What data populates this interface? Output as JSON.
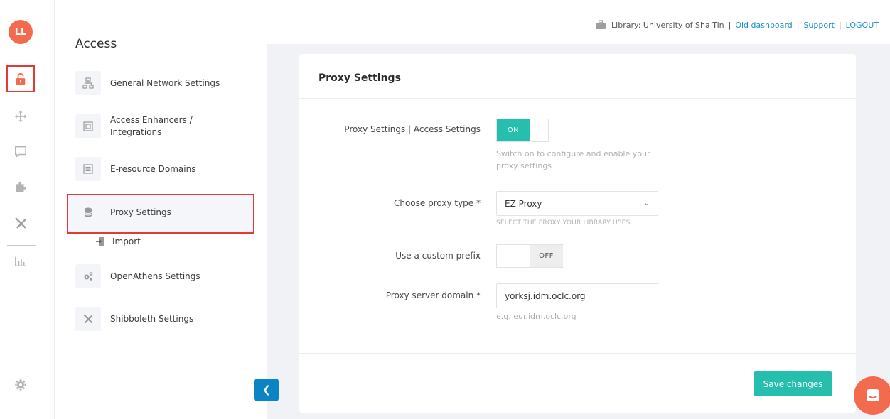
{
  "logo": {
    "text": "LL",
    "color": "#f26b4f"
  },
  "rail": {
    "items": [
      {
        "name": "lock-open-icon",
        "active": true
      },
      {
        "name": "move-arrows-icon",
        "active": false
      },
      {
        "name": "chat-square-icon",
        "active": false
      },
      {
        "name": "puzzle-icon",
        "active": false
      },
      {
        "name": "tools-icon",
        "active": false
      },
      {
        "name": "bar-chart-icon",
        "active": false
      },
      {
        "name": "gear-icon",
        "active": false
      }
    ]
  },
  "menu": {
    "title": "Access",
    "items": [
      {
        "label": "General Network Settings",
        "icon": "network-icon"
      },
      {
        "label": "Access Enhancers / Integrations",
        "icon": "integrations-icon"
      },
      {
        "label": "E-resource Domains",
        "icon": "list-icon"
      },
      {
        "label": "Proxy Settings",
        "icon": "database-icon",
        "active": true
      },
      {
        "label": "Import",
        "icon": "import-icon",
        "sub": true
      },
      {
        "label": "OpenAthens Settings",
        "icon": "cogs-icon"
      },
      {
        "label": "Shibboleth Settings",
        "icon": "tools-icon"
      }
    ]
  },
  "topbar": {
    "library": "Library: University of Sha Tin",
    "sep": "|",
    "old_dashboard": "Old dashboard",
    "support": "Support",
    "logout": "LOGOUT"
  },
  "card": {
    "title": "Proxy Settings",
    "proxy_toggle": {
      "label": "Proxy Settings | Access Settings",
      "state": "ON",
      "help": "Switch on to configure and enable your proxy settings"
    },
    "proxy_type": {
      "label": "Choose proxy type *",
      "value": "EZ Proxy",
      "help": "SELECT THE PROXY YOUR LIBRARY USES"
    },
    "custom_prefix": {
      "label": "Use a custom prefix",
      "state": "OFF"
    },
    "server_domain": {
      "label": "Proxy server domain *",
      "value": "yorksj.idm.oclc.org",
      "help": "e.g. eur.idm.oclc.org"
    },
    "save_label": "Save changes"
  },
  "colors": {
    "accent": "#26bfae",
    "link": "#1a8ec9",
    "highlight": "#e53935",
    "collapse": "#0b84c6"
  }
}
